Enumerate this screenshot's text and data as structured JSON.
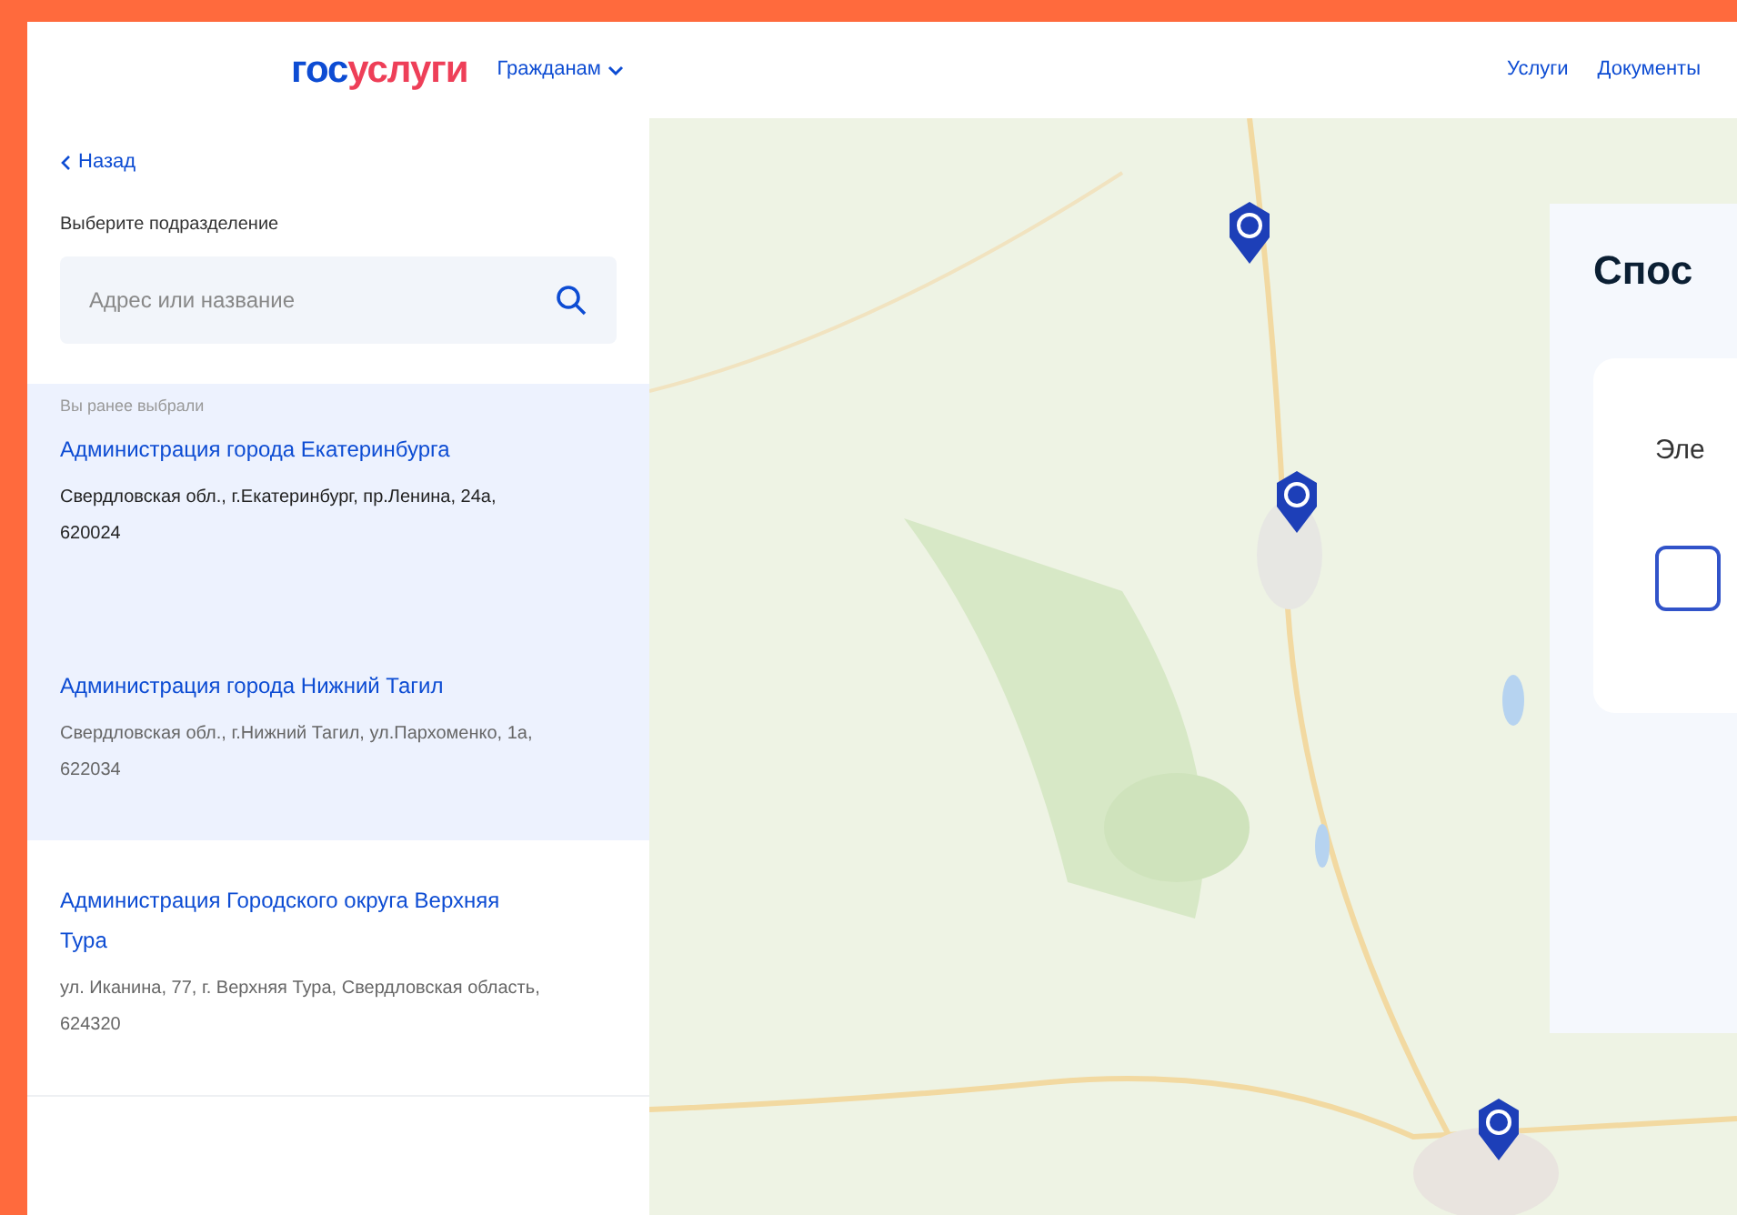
{
  "header": {
    "logo_part_1": "гос",
    "logo_part_2": "услуги",
    "audience_menu": "Гражданам",
    "nav": [
      "Услуги",
      "Документы"
    ]
  },
  "sidebar": {
    "back": "Назад",
    "label": "Выберите подразделение",
    "search": {
      "placeholder": "Адрес или название"
    },
    "previous_caption": "Вы ранее выбрали",
    "items": [
      {
        "name": "Администрация города Екатеринбурга",
        "address": "Свердловская обл., г.Екатеринбург, пр.Ленина, 24а, 620024",
        "selected": true
      },
      {
        "name": "Администрация города Нижний Тагил",
        "address": "Свердловская обл., г.Нижний Тагил, ул.Пархоменко, 1а, 622034",
        "selected": true
      },
      {
        "name": "Администрация Городского округа Верхняя Тура",
        "address": "ул. Иканина, 77, г. Верхняя Тура, Свердловская область, 624320",
        "selected": false
      }
    ]
  },
  "dialog": {
    "title": "Спос",
    "option": {
      "label": "Эле",
      "checked": false
    }
  }
}
